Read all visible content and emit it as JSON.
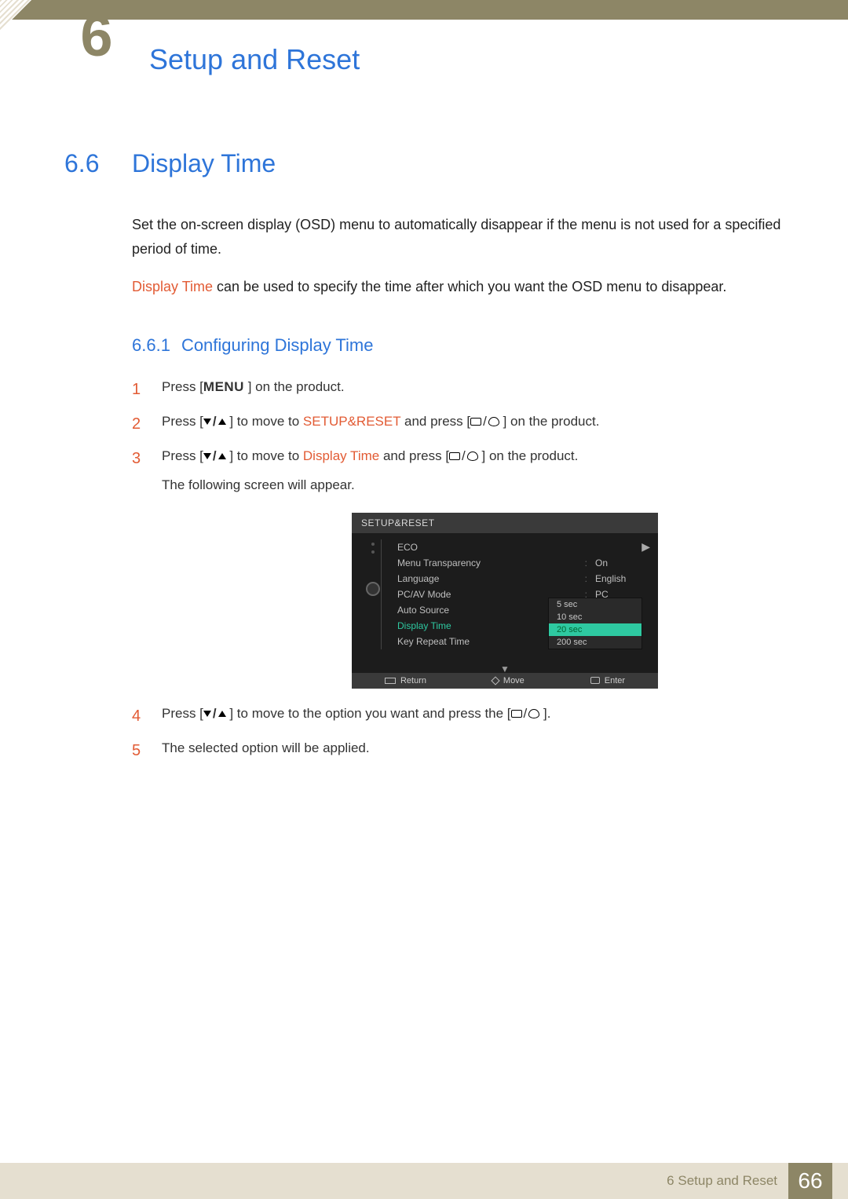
{
  "chapter": {
    "number": "6",
    "title": "Setup and Reset"
  },
  "section": {
    "number": "6.6",
    "title": "Display Time"
  },
  "intro": {
    "p1": "Set the on-screen display (OSD) menu to automatically disappear if the menu is not used for a specified period of time.",
    "p2_a": "Display Time",
    "p2_b": " can be used to specify the time after which you want the OSD menu to disappear."
  },
  "subsection": {
    "number": "6.6.1",
    "title": "Configuring Display Time"
  },
  "steps": {
    "s1_a": "Press [",
    "s1_menu": "MENU",
    "s1_b": " ] on the product.",
    "s2_a": "Press [",
    "s2_b": " ] to move to ",
    "s2_hl": "SETUP&RESET",
    "s2_c": " and press [",
    "s2_d": " ] on the product.",
    "s3_a": "Press [",
    "s3_b": " ] to move to ",
    "s3_hl": "Display Time",
    "s3_c": " and press [",
    "s3_d": " ] on the product.",
    "s3_line2": "The following screen will appear.",
    "s4_a": "Press [",
    "s4_b": " ] to move to the option you want and press the [",
    "s4_c": " ].",
    "s5": "The selected option will be applied."
  },
  "osd": {
    "title": "SETUP&RESET",
    "rows": [
      {
        "label": "ECO",
        "value": "",
        "arrow": true
      },
      {
        "label": "Menu Transparency",
        "value": "On"
      },
      {
        "label": "Language",
        "value": "English"
      },
      {
        "label": "PC/AV Mode",
        "value": "PC"
      },
      {
        "label": "Auto Source",
        "value": ""
      },
      {
        "label": "Display Time",
        "value": "",
        "active": true
      },
      {
        "label": "Key Repeat Time",
        "value": ""
      }
    ],
    "popup": [
      "5 sec",
      "10 sec",
      "20 sec",
      "200 sec"
    ],
    "popup_selected": "20 sec",
    "footer": {
      "return": "Return",
      "move": "Move",
      "enter": "Enter"
    }
  },
  "footer": {
    "label": "6 Setup and Reset",
    "page": "66"
  }
}
